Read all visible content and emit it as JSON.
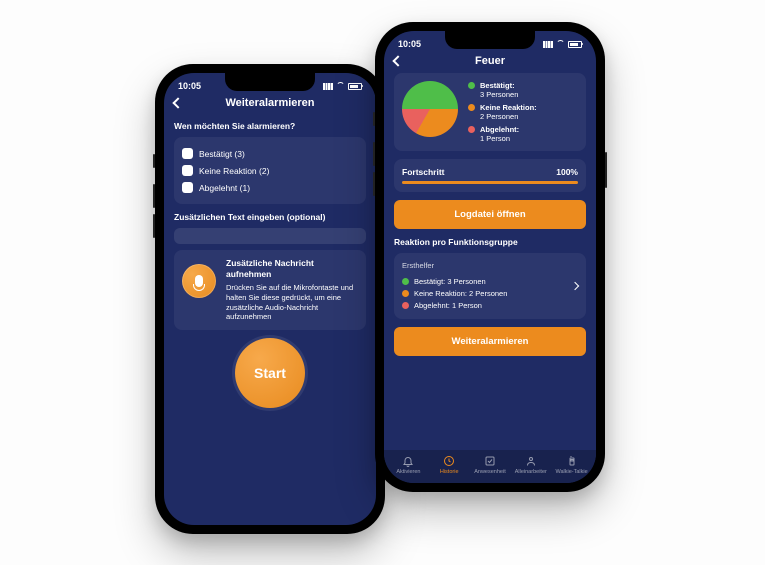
{
  "status": {
    "time": "10:05"
  },
  "left": {
    "title": "Weiteralarmieren",
    "question": "Wen möchten Sie alarmieren?",
    "options": [
      {
        "label": "Bestätigt (3)"
      },
      {
        "label": "Keine Reaktion (2)"
      },
      {
        "label": "Abgelehnt (1)"
      }
    ],
    "extra_text_label": "Zusätzlichen Text eingeben (optional)",
    "record_title": "Zusätzliche Nachricht aufnehmen",
    "record_desc": "Drücken Sie auf die Mikrofontaste und halten Sie diese gedrückt, um eine zusätzliche Audio-Nachricht aufzunehmen",
    "start_label": "Start"
  },
  "right": {
    "title": "Feuer",
    "chart_data": {
      "type": "pie",
      "title": "Feuer",
      "series": [
        {
          "name": "Bestätigt",
          "value": 3,
          "color": "#4fbe49"
        },
        {
          "name": "Keine Reaktion",
          "value": 2,
          "color": "#ec8b1e"
        },
        {
          "name": "Abgelehnt",
          "value": 1,
          "color": "#e9615e"
        }
      ]
    },
    "legend": [
      {
        "title": "Bestätigt:",
        "sub": "3 Personen"
      },
      {
        "title": "Keine Reaktion:",
        "sub": "2 Personen"
      },
      {
        "title": "Abgelehnt:",
        "sub": "1 Person"
      }
    ],
    "progress_label": "Fortschritt",
    "progress_pct": "100%",
    "progress_value": 100,
    "logfile_label": "Logdatei öffnen",
    "reaction_label": "Reaktion pro Funktionsgruppe",
    "group": {
      "name": "Ersthelfer",
      "lines": [
        {
          "dot": "green",
          "text": "Bestätigt: 3 Personen"
        },
        {
          "dot": "orange",
          "text": "Keine Reaktion: 2 Personen"
        },
        {
          "dot": "red",
          "text": "Abgelehnt: 1 Person"
        }
      ]
    },
    "cta_label": "Weiteralarmieren",
    "tabs": [
      {
        "label": "Aktivieren"
      },
      {
        "label": "Historie",
        "active": true
      },
      {
        "label": "Anwesenheit"
      },
      {
        "label": "Alleinarbeiter"
      },
      {
        "label": "Walkie-Talkie"
      }
    ]
  },
  "colors": {
    "accent": "#ec8b1e",
    "bg": "#1f2b64"
  }
}
